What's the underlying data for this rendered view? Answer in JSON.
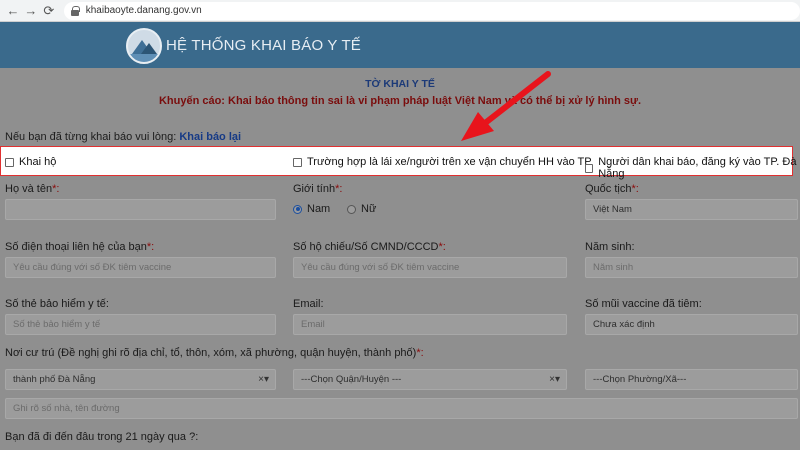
{
  "browser": {
    "url": "khaibaoyte.danang.gov.vn",
    "back_icon": "arrow-left-icon",
    "forward_icon": "arrow-right-icon",
    "reload_icon": "reload-icon"
  },
  "header": {
    "site_title": "HỆ THỐNG KHAI BÁO Y TẾ"
  },
  "form": {
    "title": "TỜ KHAI Y TẾ",
    "warning": "Khuyến cáo: Khai báo thông tin sai là vi phạm pháp luật Việt Nam và có thể bị xử lý hình sự.",
    "prev_text": "Nếu bạn đã từng khai báo vui lòng: ",
    "prev_link": "Khai báo lại",
    "options": [
      "Khai hộ",
      "Trường hợp là lái xe/người trên xe vận chuyển HH vào TP",
      "Người dân khai báo, đăng ký vào TP. Đà Nẵng"
    ],
    "fullname": {
      "label": "Họ và tên",
      "required": "*:",
      "value": ""
    },
    "gender": {
      "label": "Giới tính",
      "required": "*:",
      "options": [
        "Nam",
        "Nữ"
      ],
      "selected": "Nam"
    },
    "nationality": {
      "label": "Quốc tịch",
      "required": "*:",
      "value": "Việt Nam"
    },
    "phone": {
      "label": "Số điện thoại liên hệ của bạn",
      "required": "*:",
      "placeholder": "Yêu cầu đúng với số ĐK tiêm vaccine"
    },
    "passport": {
      "label": "Số hộ chiếu/Số CMND/CCCD",
      "required": "*:",
      "placeholder": "Yêu cầu đúng với số ĐK tiêm vaccine"
    },
    "birth_year": {
      "label": "Năm sinh:",
      "placeholder": "Năm sinh"
    },
    "insurance": {
      "label": "Số thẻ bảo hiểm y tế:",
      "placeholder": "Số thẻ bảo hiểm y tế"
    },
    "email": {
      "label": "Email:",
      "placeholder": "Email"
    },
    "vaccine": {
      "label": "Số mũi vaccine đã tiêm:",
      "value": "Chưa xác định"
    },
    "residence": {
      "label": "Nơi cư trú (Đề nghị ghi rõ địa chỉ, tổ, thôn, xóm, xã phường, quận huyện, thành phố)",
      "required": "*:",
      "city": "thành phố Đà Nẵng",
      "district": "---Chọn Quận/Huyện ---",
      "ward": "---Chọn Phường/Xã---",
      "street_placeholder": "Ghi rõ số nhà, tên đường",
      "clear_caret": "×▾"
    },
    "travel_question": "Bạn đã đi đến đâu trong 21 ngày qua ?:"
  },
  "colors": {
    "highlight_border": "#e03030",
    "arrow": "#e8141c",
    "header_bg": "#3a6a8c"
  }
}
